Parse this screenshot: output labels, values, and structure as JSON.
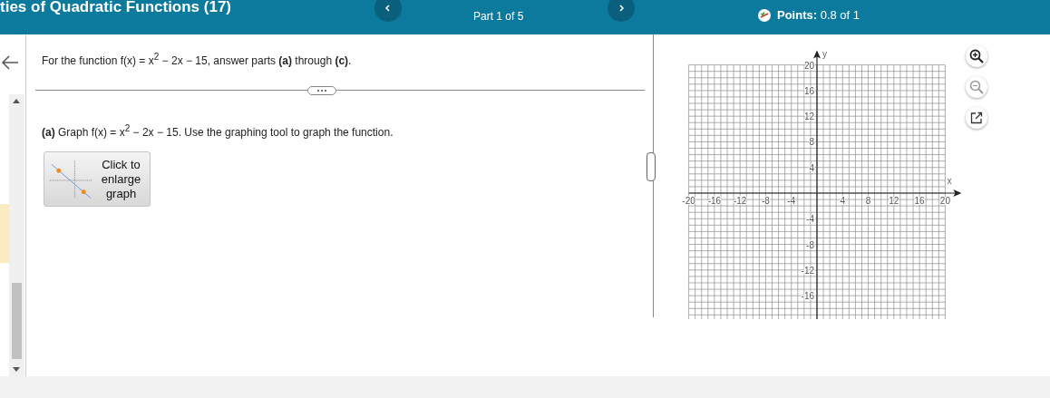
{
  "header": {
    "title": "ties of Quadratic Functions (17)",
    "part": "Part 1 of 5",
    "points": "**Points:** 0.8 of 1"
  },
  "question": {
    "intro": "For the function f(x) = x$^{2}$ − 2x − 15, answer parts **(a)** through **(c)**.",
    "part_a": "**(a)** Graph f(x) = x$^{2}$ − 2x − 15. Use the graphing tool to graph the function.",
    "enlarge_button": "Click to enlarge graph"
  },
  "graph": {
    "chart_data": {
      "type": "scatter",
      "grid": true,
      "xlabel": "x",
      "ylabel": "y",
      "xlim": [
        -20,
        20
      ],
      "ylim": [
        -20,
        20
      ],
      "xticks": [
        -20,
        -16,
        -12,
        -8,
        -4,
        4,
        8,
        12,
        16,
        20
      ],
      "yticks": [
        -16,
        -12,
        -8,
        -4,
        4,
        8,
        12,
        16,
        20
      ]
    }
  }
}
